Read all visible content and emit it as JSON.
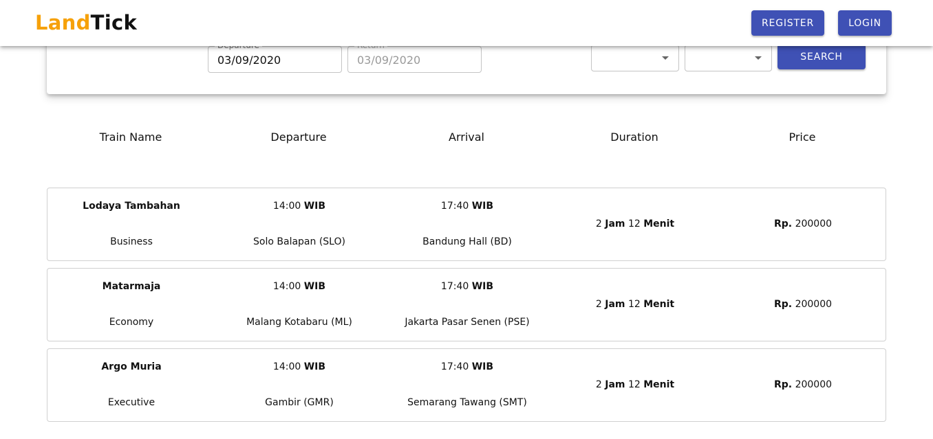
{
  "app": {
    "logo_part1": "Land",
    "logo_part2": "Tick",
    "brand_color": "#f6a10a",
    "accent_color": "#3f51b5"
  },
  "header": {
    "register_label": "REGISTER",
    "login_label": "LOGIN"
  },
  "search": {
    "departure_label": "Departure",
    "departure_value": "03/09/2020",
    "return_label": "Return",
    "return_value": "03/09/2020",
    "select_1_value": "",
    "select_2_value": "",
    "search_label": "SEARCH"
  },
  "columns": [
    "Train Name",
    "Departure",
    "Arrival",
    "Duration",
    "Price"
  ],
  "trains": [
    {
      "name": "Lodaya Tambahan",
      "class": "Business",
      "dep_time": "14:00",
      "dep_tz": "WIB",
      "dep_station": "Solo Balapan (SLO)",
      "arr_time": "17:40",
      "arr_tz": "WIB",
      "arr_station": "Bandung Hall (BD)",
      "dur_hours": "2",
      "dur_hours_unit": "Jam",
      "dur_minutes": "12",
      "dur_minutes_unit": "Menit",
      "price_currency": "Rp.",
      "price": "200000"
    },
    {
      "name": "Matarmaja",
      "class": "Economy",
      "dep_time": "14:00",
      "dep_tz": "WIB",
      "dep_station": "Malang Kotabaru (ML)",
      "arr_time": "17:40",
      "arr_tz": "WIB",
      "arr_station": "Jakarta Pasar Senen (PSE)",
      "dur_hours": "2",
      "dur_hours_unit": "Jam",
      "dur_minutes": "12",
      "dur_minutes_unit": "Menit",
      "price_currency": "Rp.",
      "price": "200000"
    },
    {
      "name": "Argo Muria",
      "class": "Executive",
      "dep_time": "14:00",
      "dep_tz": "WIB",
      "dep_station": "Gambir (GMR)",
      "arr_time": "17:40",
      "arr_tz": "WIB",
      "arr_station": "Semarang Tawang (SMT)",
      "dur_hours": "2",
      "dur_hours_unit": "Jam",
      "dur_minutes": "12",
      "dur_minutes_unit": "Menit",
      "price_currency": "Rp.",
      "price": "200000"
    }
  ]
}
